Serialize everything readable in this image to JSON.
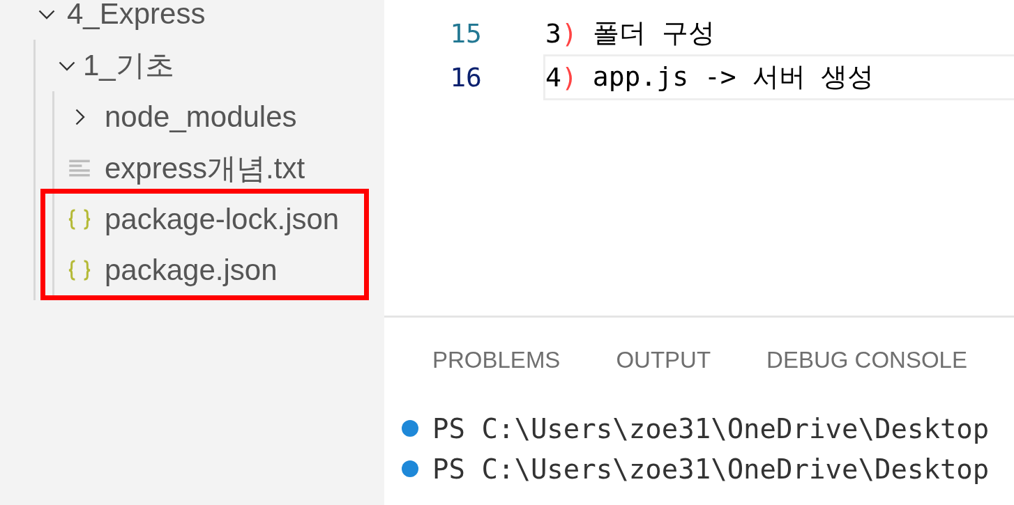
{
  "explorer": {
    "tree": [
      {
        "label": "4_Express",
        "expanded": true,
        "children": [
          {
            "label": "1_기초",
            "expanded": true,
            "children": [
              {
                "label": "node_modules",
                "kind": "folder",
                "expanded": false,
                "highlighted": false
              },
              {
                "label": "express개념.txt",
                "kind": "text",
                "highlighted": false
              },
              {
                "label": "package-lock.json",
                "kind": "json",
                "highlighted": true
              },
              {
                "label": "package.json",
                "kind": "json",
                "highlighted": true
              }
            ]
          }
        ]
      }
    ]
  },
  "editor": {
    "lines": [
      {
        "number": "15",
        "list_no": "3",
        "bracket": ")",
        "text": "폴더 구성",
        "current": false
      },
      {
        "number": "16",
        "list_no": "4",
        "bracket": ")",
        "text": "app.js -> 서버 생성",
        "current": true
      }
    ]
  },
  "panel": {
    "tabs": [
      {
        "label": "PROBLEMS"
      },
      {
        "label": "OUTPUT"
      },
      {
        "label": "DEBUG CONSOLE"
      }
    ],
    "terminal": [
      "PS C:\\Users\\zoe31\\OneDrive\\Desktop",
      "PS C:\\Users\\zoe31\\OneDrive\\Desktop"
    ]
  }
}
